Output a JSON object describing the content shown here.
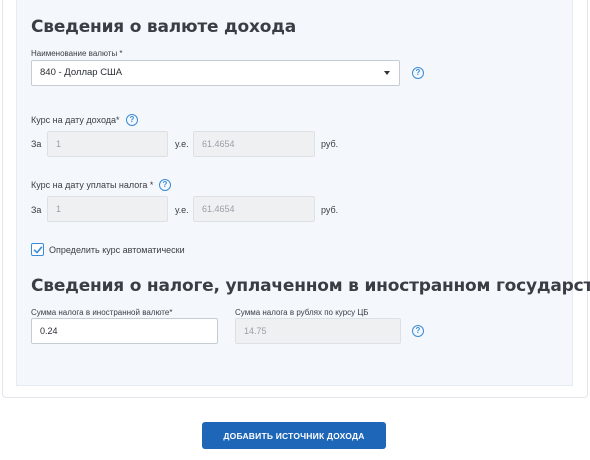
{
  "currency_section": {
    "title": "Сведения о валюте дохода",
    "currency_label": "Наименование валюты *",
    "currency_value": "840 - Доллар США",
    "rate_income_label": "Курс на дату дохода*",
    "rate_tax_label": "Курс на дату уплаты налога *",
    "per_label": "За",
    "unit_label": "у.е.",
    "rub_label": "руб.",
    "rate_income_units": "1",
    "rate_income_value": "61.4654",
    "rate_tax_units": "1",
    "rate_tax_value": "61.4654",
    "auto_rate_label": "Определить курс автоматически",
    "auto_rate_checked": true
  },
  "tax_section": {
    "title": "Сведения о налоге, уплаченном в иностранном государстве",
    "foreign_tax_label": "Сумма налога в иностранной валюте*",
    "foreign_tax_value": "0.24",
    "rub_tax_label": "Сумма налога в рублях по курсу ЦБ",
    "rub_tax_value": "14.75"
  },
  "help_symbol": "?",
  "actions": {
    "add_source_label": "ДОБАВИТЬ ИСТОЧНИК ДОХОДА"
  },
  "colors": {
    "accent": "#3b8bd6",
    "button": "#1e67b8",
    "panel": "#f4f8fc"
  }
}
